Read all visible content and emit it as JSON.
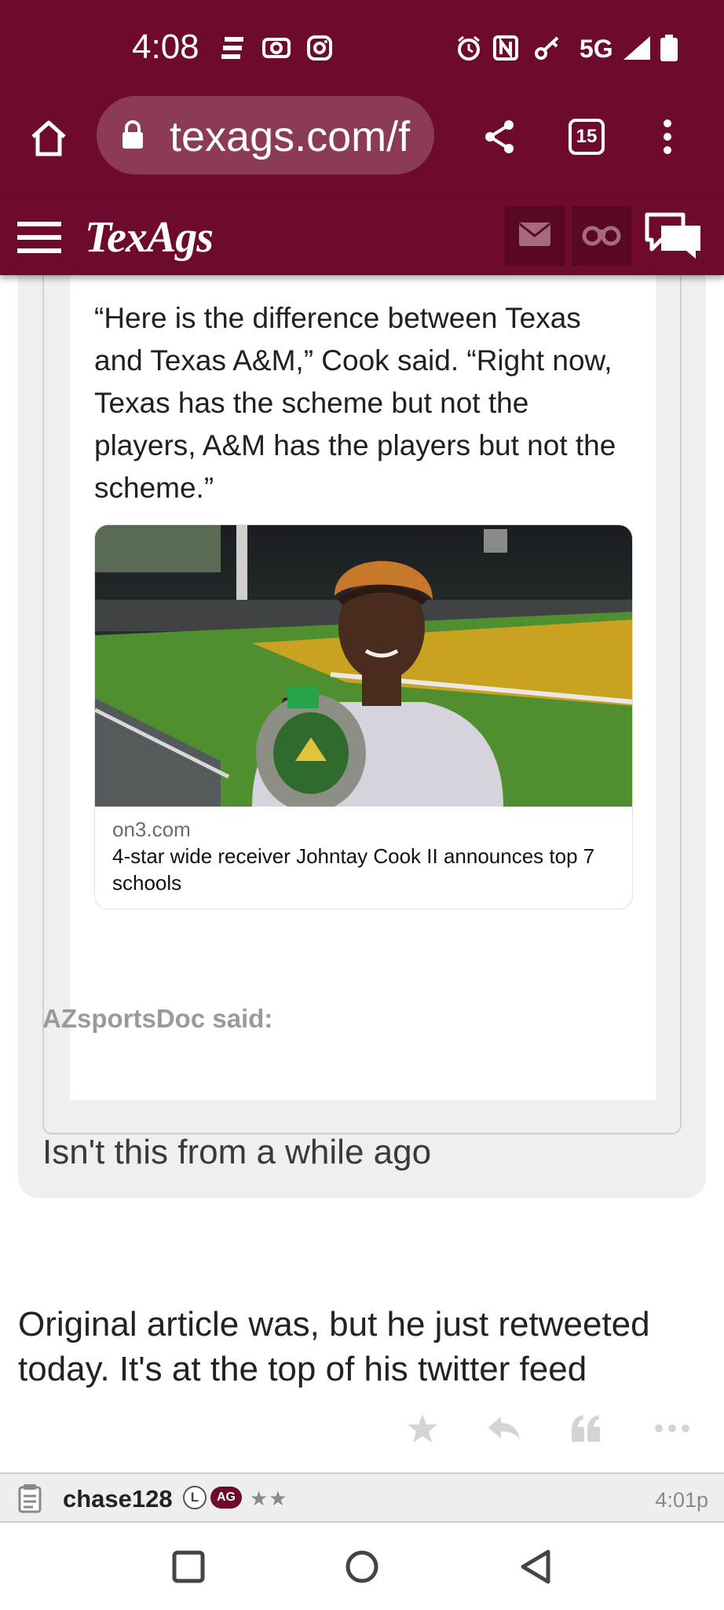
{
  "status_bar": {
    "time": "4:08",
    "network": "5G"
  },
  "browser": {
    "url": "texags.com/f",
    "tab_count": "15"
  },
  "site": {
    "logo": "TexAgs"
  },
  "quote": {
    "tweet_text": "“Here is the difference between Texas and Texas A&M,” Cook said. “Right now, Texas has the scheme but not the players, A&M has the players but not the scheme.”",
    "link_domain": "on3.com",
    "link_title": "4-star wide receiver Johntay Cook II announces top 7 schools",
    "author_line": "AZsportsDoc said:",
    "body": "Isn't this from a while ago"
  },
  "reply": {
    "text": "Original article was, but he just retweeted today. It's at the top of his twitter feed"
  },
  "next_post": {
    "username": "chase128",
    "badge_l": "L",
    "badge_ag": "AG",
    "stars": "★★",
    "time": "4:01p"
  },
  "colors": {
    "maroon": "#6e0a2e",
    "maroon_dark": "#590824"
  }
}
